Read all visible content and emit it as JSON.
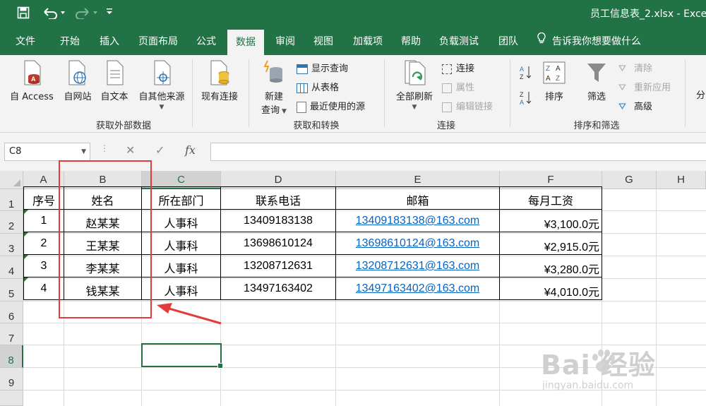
{
  "app": {
    "document_title": "员工信息表_2.xlsx - Exce"
  },
  "quick_access": {
    "save": "save-icon",
    "undo": "undo-icon",
    "redo": "redo-icon",
    "customize": "customize-icon"
  },
  "ribbon_tabs": [
    "文件",
    "开始",
    "插入",
    "页面布局",
    "公式",
    "数据",
    "审阅",
    "视图",
    "加载项",
    "帮助",
    "负载测试",
    "团队"
  ],
  "active_tab": "数据",
  "tell_me": "告诉我你想要做什么",
  "ribbon": {
    "get_external": {
      "label": "获取外部数据",
      "from_access": "自 Access",
      "from_web": "自网站",
      "from_text": "自文本",
      "from_other": "自其他来源",
      "existing_connections": "现有连接"
    },
    "get_transform": {
      "label": "获取和转换",
      "new_query": "新建",
      "new_query_2": "查询",
      "show_queries": "显示查询",
      "from_table": "从表格",
      "recent_sources": "最近使用的源"
    },
    "connections": {
      "label": "连接",
      "refresh_all": "全部刷新",
      "connections": "连接",
      "properties": "属性",
      "edit_links": "编辑链接"
    },
    "sort_filter": {
      "label": "排序和筛选",
      "sort": "排序",
      "filter": "筛选",
      "clear": "清除",
      "reapply": "重新应用",
      "advanced": "高级",
      "next": "分"
    }
  },
  "formula_bar": {
    "name_box": "C8",
    "cancel": "✕",
    "enter": "✓",
    "fx": "fx",
    "value": ""
  },
  "columns": [
    "A",
    "B",
    "C",
    "D",
    "E",
    "F",
    "G",
    "H"
  ],
  "selected_column": "C",
  "rows": [
    "1",
    "2",
    "3",
    "4",
    "5",
    "6",
    "7",
    "8",
    "9"
  ],
  "selected_row": "8",
  "table": {
    "headers": [
      "序号",
      "姓名",
      "所在部门",
      "联系电话",
      "邮箱",
      "每月工资"
    ],
    "rows": [
      [
        "1",
        "赵某某",
        "人事科",
        "13409183138",
        "13409183138@163.com",
        "¥3,100.0元"
      ],
      [
        "2",
        "王某某",
        "人事科",
        "13698610124",
        "13698610124@163.com",
        "¥2,915.0元"
      ],
      [
        "3",
        "李某某",
        "人事科",
        "13208712631",
        "13208712631@163.com",
        "¥3,280.0元"
      ],
      [
        "4",
        "钱某某",
        "人事科",
        "13497163402",
        "13497163402@163.com",
        "¥4,010.0元"
      ]
    ]
  },
  "watermark": {
    "main": "Bai 经验",
    "sub": "jingyan.baidu.com"
  }
}
